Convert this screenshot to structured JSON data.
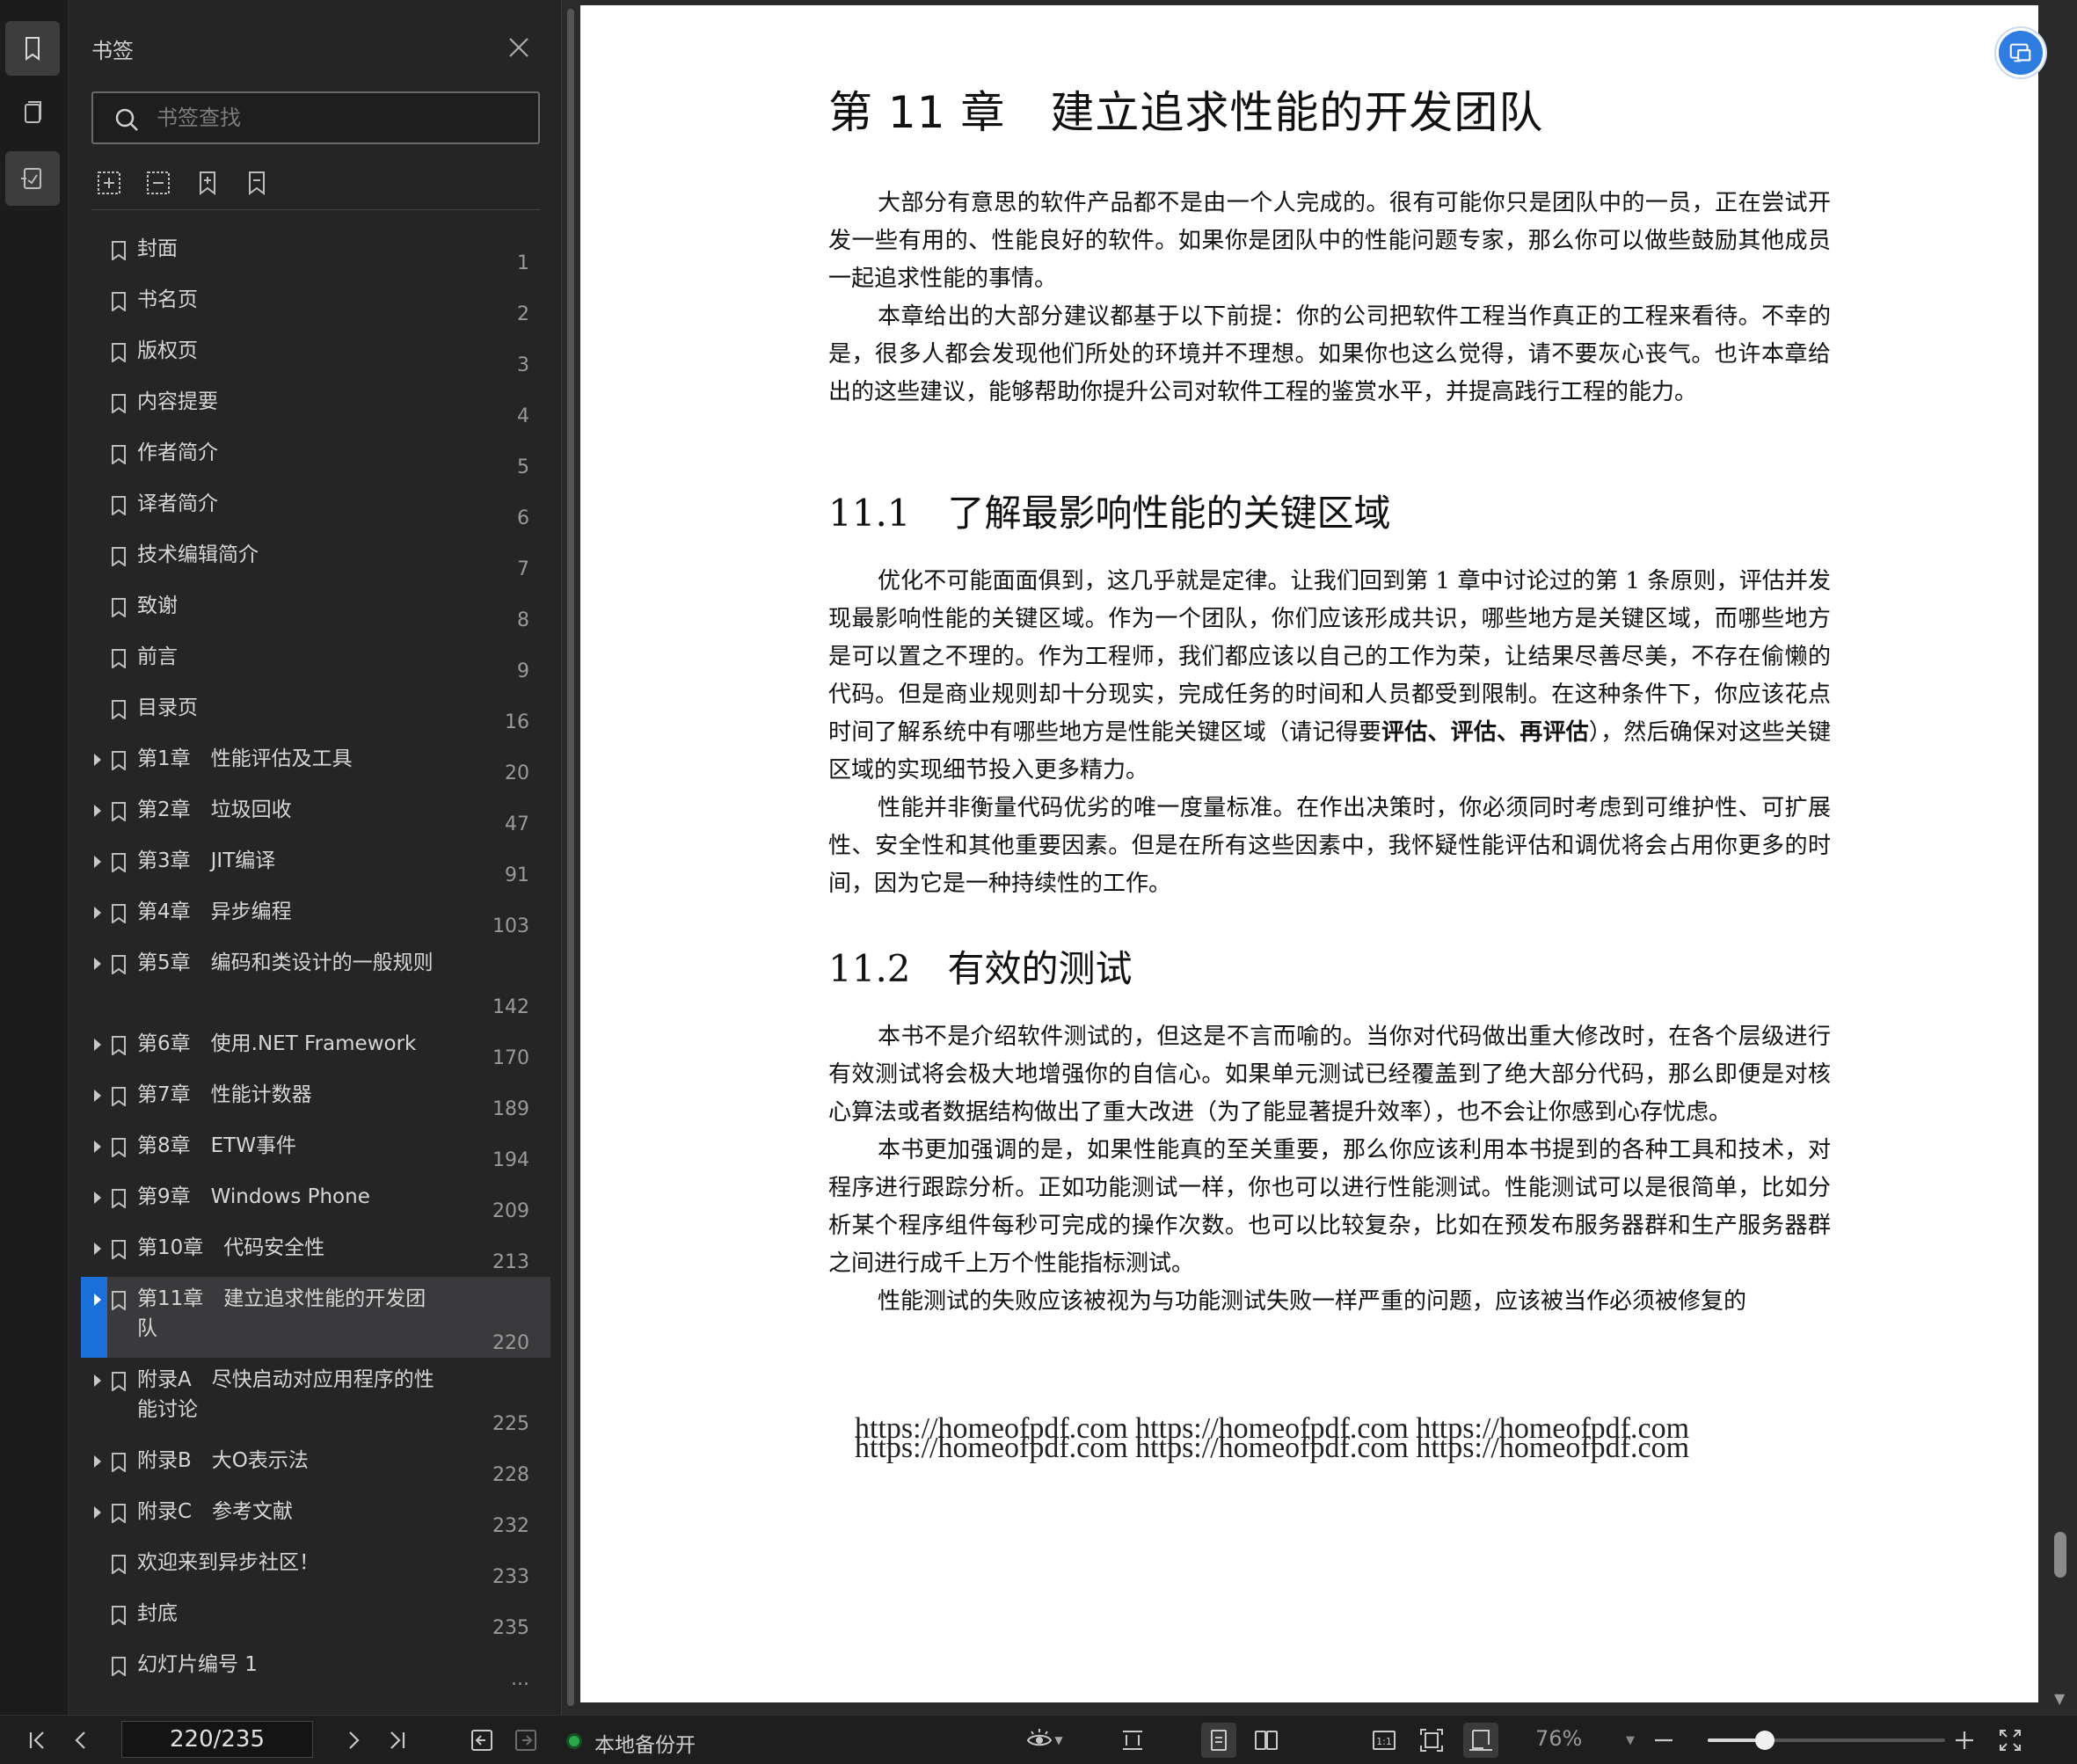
{
  "rail": {
    "items": [
      {
        "name": "bookmark-tab",
        "active": true
      },
      {
        "name": "thumbnail-tab",
        "active": false
      },
      {
        "name": "annotation-tab",
        "active": false
      }
    ]
  },
  "panel": {
    "title": "书签",
    "search_placeholder": "书签查找",
    "items": [
      {
        "label": "封面",
        "page": "1",
        "expandable": false
      },
      {
        "label": "书名页",
        "page": "2",
        "expandable": false
      },
      {
        "label": "版权页",
        "page": "3",
        "expandable": false
      },
      {
        "label": "内容提要",
        "page": "4",
        "expandable": false
      },
      {
        "label": "作者简介",
        "page": "5",
        "expandable": false
      },
      {
        "label": "译者简介",
        "page": "6",
        "expandable": false
      },
      {
        "label": "技术编辑简介",
        "page": "7",
        "expandable": false
      },
      {
        "label": "致谢",
        "page": "8",
        "expandable": false
      },
      {
        "label": "前言",
        "page": "9",
        "expandable": false
      },
      {
        "label": "目录页",
        "page": "16",
        "expandable": false
      },
      {
        "label": "第1章　性能评估及工具",
        "page": "20",
        "expandable": true
      },
      {
        "label": "第2章　垃圾回收",
        "page": "47",
        "expandable": true
      },
      {
        "label": "第3章　JIT编译",
        "page": "91",
        "expandable": true
      },
      {
        "label": "第4章　异步编程",
        "page": "103",
        "expandable": true
      },
      {
        "label": "第5章　编码和类设计的一般规则",
        "page": "142",
        "expandable": true,
        "lines": 2
      },
      {
        "label": "第6章　使用.NET Framework",
        "page": "170",
        "expandable": true
      },
      {
        "label": "第7章　性能计数器",
        "page": "189",
        "expandable": true
      },
      {
        "label": "第8章　ETW事件",
        "page": "194",
        "expandable": true
      },
      {
        "label": "第9章　Windows Phone",
        "page": "209",
        "expandable": true
      },
      {
        "label": "第10章　代码安全性",
        "page": "213",
        "expandable": true
      },
      {
        "label": "第11章　建立追求性能的开发团队",
        "page": "220",
        "expandable": true,
        "lines": 2,
        "active": true
      },
      {
        "label": "附录A　尽快启动对应用程序的性能讨论",
        "page": "225",
        "expandable": true,
        "lines": 2
      },
      {
        "label": "附录B　大O表示法",
        "page": "228",
        "expandable": true
      },
      {
        "label": "附录C　参考文献",
        "page": "232",
        "expandable": true
      },
      {
        "label": "欢迎来到异步社区！",
        "page": "233",
        "expandable": false
      },
      {
        "label": "封底",
        "page": "235",
        "expandable": false
      },
      {
        "label": "幻灯片编号 1",
        "page": "...",
        "expandable": false
      }
    ]
  },
  "doc": {
    "chapter_title": "第 11 章　建立追求性能的开发团队",
    "intro_paragraphs": [
      "大部分有意思的软件产品都不是由一个人完成的。很有可能你只是团队中的一员，正在尝试开发一些有用的、性能良好的软件。如果你是团队中的性能问题专家，那么你可以做些鼓励其他成员一起追求性能的事情。",
      "本章给出的大部分建议都基于以下前提：你的公司把软件工程当作真正的工程来看待。不幸的是，很多人都会发现他们所处的环境并不理想。如果你也这么觉得，请不要灰心丧气。也许本章给出的这些建议，能够帮助你提升公司对软件工程的鉴赏水平，并提高践行工程的能力。"
    ],
    "section1_title": "11.1　了解最影响性能的关键区域",
    "section1_p1_start": "优化不可能面面俱到，这几乎就是定律。让我们回到第 1 章中讨论过的第 1 条原则，评估并发现最影响性能的关键区域。作为一个团队，你们应该形成共识，哪些地方是关键区域，而哪些地方是可以置之不理的。作为工程师，我们都应该以自己的工作为荣，让结果尽善尽美，不存在偷懒的代码。但是商业规则却十分现实，完成任务的时间和人员都受到限制。在这种条件下，你应该花点时间了解系统中有哪些地方是性能关键区域（请记得要",
    "section1_p1_bold": "评估、评估、再评估",
    "section1_p1_end": "），然后确保对这些关键区域的实现细节投入更多精力。",
    "section1_p2": "性能并非衡量代码优劣的唯一度量标准。在作出决策时，你必须同时考虑到可维护性、可扩展性、安全性和其他重要因素。但是在所有这些因素中，我怀疑性能评估和调优将会占用你更多的时间，因为它是一种持续性的工作。",
    "section2_title": "11.2　有效的测试",
    "section2_paragraphs": [
      "本书不是介绍软件测试的，但这是不言而喻的。当你对代码做出重大修改时，在各个层级进行有效测试将会极大地增强你的自信心。如果单元测试已经覆盖到了绝大部分代码，那么即便是对核心算法或者数据结构做出了重大改进（为了能显著提升效率），也不会让你感到心存忧虑。",
      "本书更加强调的是，如果性能真的至关重要，那么你应该利用本书提到的各种工具和技术，对程序进行跟踪分析。正如功能测试一样，你也可以进行性能测试。性能测试可以是很简单，比如分析某个程序组件每秒可完成的操作次数。也可以比较复杂，比如在预发布服务器群和生产服务器群之间进行成千上万个性能指标测试。",
      "性能测试的失败应该被视为与功能测试失败一样严重的问题，应该被当作必须被修复的"
    ],
    "watermark_line1": "https://homeofpdf.com https://homeofpdf.com https://homeofpdf.com",
    "watermark_line2": "https://homeofpdf.com https://homeofpdf.com https://homeofpdf.com"
  },
  "toolbar": {
    "page_value": "220/235",
    "backup_label": "本地备份开",
    "zoom_label": "76%",
    "zoom_fraction": 0.24,
    "icons": [
      "first-page-icon",
      "prev-page-icon",
      "next-page-icon",
      "last-page-icon",
      "back-icon",
      "forward-icon",
      "eye-icon",
      "scroll-mode-icon",
      "single-page-icon",
      "double-page-icon",
      "actual-size-icon",
      "fit-page-icon",
      "fit-width-icon",
      "zoom-dropdown-icon",
      "zoom-out-icon",
      "zoom-in-icon",
      "fullscreen-icon"
    ]
  },
  "colors": {
    "accent": "#1a6fd8",
    "backup_status": "#2aa84a",
    "float_button": "#2f7de1"
  }
}
